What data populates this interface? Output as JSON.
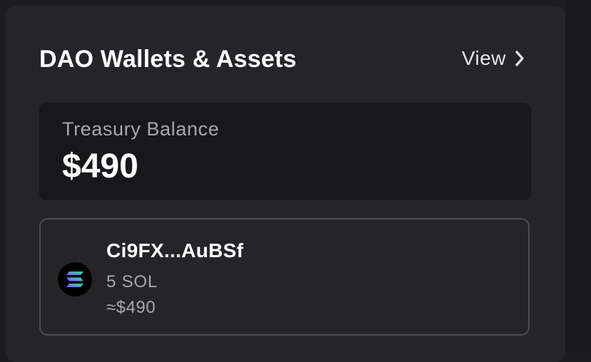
{
  "card": {
    "title": "DAO Wallets & Assets",
    "view_label": "View",
    "view_icon": "chevron-right-icon"
  },
  "treasury": {
    "label": "Treasury Balance",
    "value": "$490"
  },
  "wallets": [
    {
      "address": "Ci9FX...AuBSf",
      "amount": "5 SOL",
      "usd_value": "≈$490",
      "token_icon": "solana-icon"
    }
  ],
  "colors": {
    "page_background": "#1d1d21",
    "card_background": "#252529",
    "treasury_background": "#18181c",
    "primary_text": "#ffffff",
    "secondary_text": "#a7a7af",
    "border": "#4c4c53",
    "solana_gradient": [
      "#9945ff",
      "#14f195"
    ]
  }
}
